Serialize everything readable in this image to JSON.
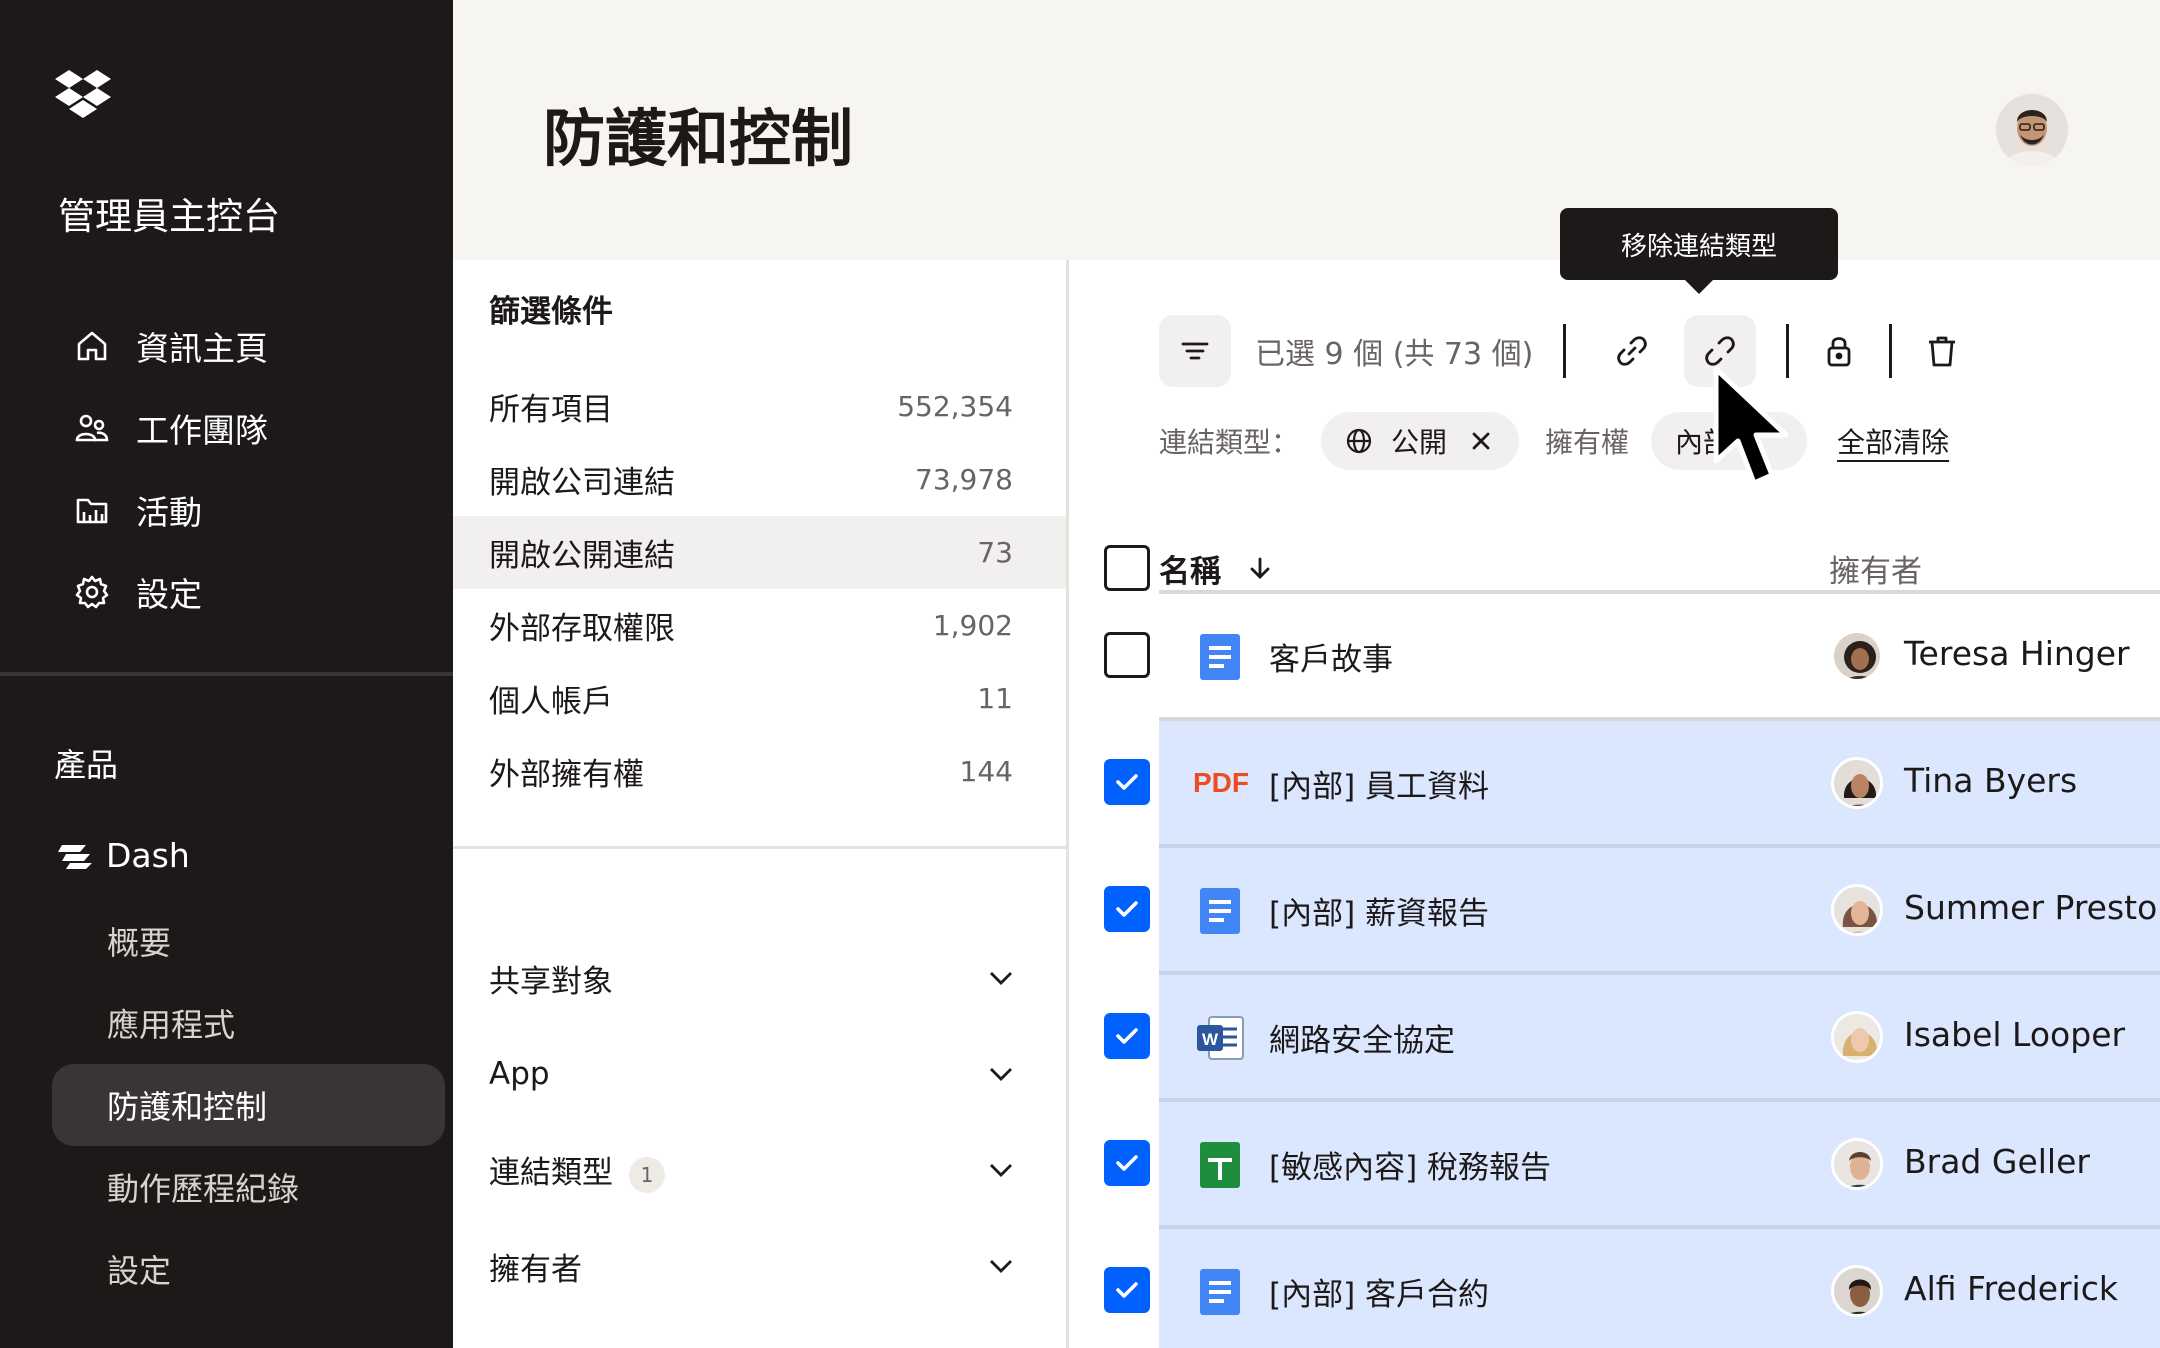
{
  "sidebar": {
    "console_title": "管理員主控台",
    "nav": [
      {
        "icon": "home-icon",
        "label": "資訊主頁"
      },
      {
        "icon": "team-icon",
        "label": "工作團隊"
      },
      {
        "icon": "activity-icon",
        "label": "活動"
      },
      {
        "icon": "gear-icon",
        "label": "設定"
      }
    ],
    "products_label": "產品",
    "dash_label": "Dash",
    "sub_items": [
      "概要",
      "應用程式",
      "防護和控制",
      "動作歷程紀錄",
      "設定"
    ],
    "active_sub": "防護和控制"
  },
  "header": {
    "title": "防護和控制"
  },
  "filters": {
    "heading": "篩選條件",
    "items": [
      {
        "label": "所有項目",
        "count": "552,354"
      },
      {
        "label": "開啟公司連結",
        "count": "73,978"
      },
      {
        "label": "開啟公開連結",
        "count": "73"
      },
      {
        "label": "外部存取權限",
        "count": "1,902"
      },
      {
        "label": "個人帳戶",
        "count": "11"
      },
      {
        "label": "外部擁有權",
        "count": "144"
      }
    ],
    "facets": [
      {
        "label": "共享對象",
        "badge": ""
      },
      {
        "label": "App",
        "badge": ""
      },
      {
        "label": "連結類型",
        "badge": "1"
      },
      {
        "label": "擁有者",
        "badge": ""
      }
    ]
  },
  "toolbar": {
    "selection_text": "已選 9 個 (共 73 個)",
    "tooltip": "移除連結類型"
  },
  "chips": {
    "link_type_label": "連結類型：",
    "public_chip": "公開",
    "ownership_label": "擁有權",
    "internal_chip": "內部",
    "clear_all": "全部清除"
  },
  "table": {
    "col_name": "名稱",
    "col_owner": "擁有者",
    "rows": [
      {
        "type": "doc",
        "name": "客戶故事",
        "owner": "Teresa Hinger",
        "selected": false
      },
      {
        "type": "pdf",
        "type_label": "PDF",
        "name": "[內部] 員工資料",
        "owner": "Tina Byers",
        "selected": true
      },
      {
        "type": "doc",
        "name": "[內部] 薪資報告",
        "owner": "Summer Preston",
        "selected": true
      },
      {
        "type": "word",
        "name": "網路安全協定",
        "owner": "Isabel Looper",
        "selected": true
      },
      {
        "type": "sheet",
        "name": "[敏感內容] 稅務報告",
        "owner": "Brad Geller",
        "selected": true
      },
      {
        "type": "doc",
        "name": "[內部] 客戶合約",
        "owner": "Alfi Frederick",
        "selected": true
      }
    ]
  },
  "colors": {
    "accent": "#0061fe",
    "sidebar_bg": "#1e1919",
    "selected_row": "#dbe7fe",
    "pdf": "#f04a23",
    "sheet": "#1e8e3e",
    "doc": "#4285f4"
  }
}
